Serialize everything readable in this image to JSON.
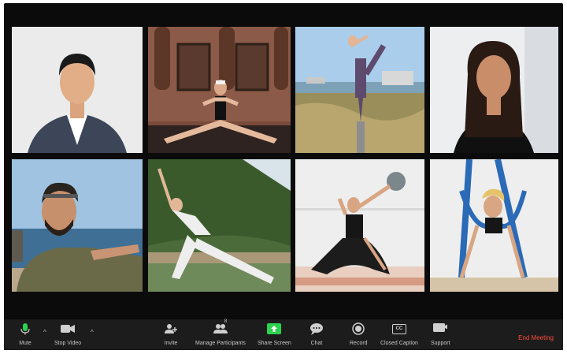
{
  "toolbar": {
    "mute": "Mute",
    "stop_video": "Stop Video",
    "invite": "Invite",
    "manage_participants": "Manage Participants",
    "participant_count": "8",
    "share_screen": "Share Screen",
    "chat": "Chat",
    "record": "Record",
    "closed_caption": "Closed Caption",
    "closed_caption_icon_text": "CC",
    "support": "Support",
    "end_meeting": "End Meeting"
  },
  "icons": {
    "mute": "microphone-icon",
    "stop_video": "video-camera-icon",
    "invite": "add-person-icon",
    "manage_participants": "participants-icon",
    "share_screen": "share-screen-icon",
    "chat": "chat-bubble-icon",
    "record": "record-icon",
    "closed_caption": "closed-caption-icon",
    "support": "support-icon"
  },
  "colors": {
    "share_screen": "#2bd34f",
    "end_meeting": "#ff4b3e",
    "toolbar_bg": "#1c1c1c",
    "window_bg": "#0b0b0b"
  }
}
